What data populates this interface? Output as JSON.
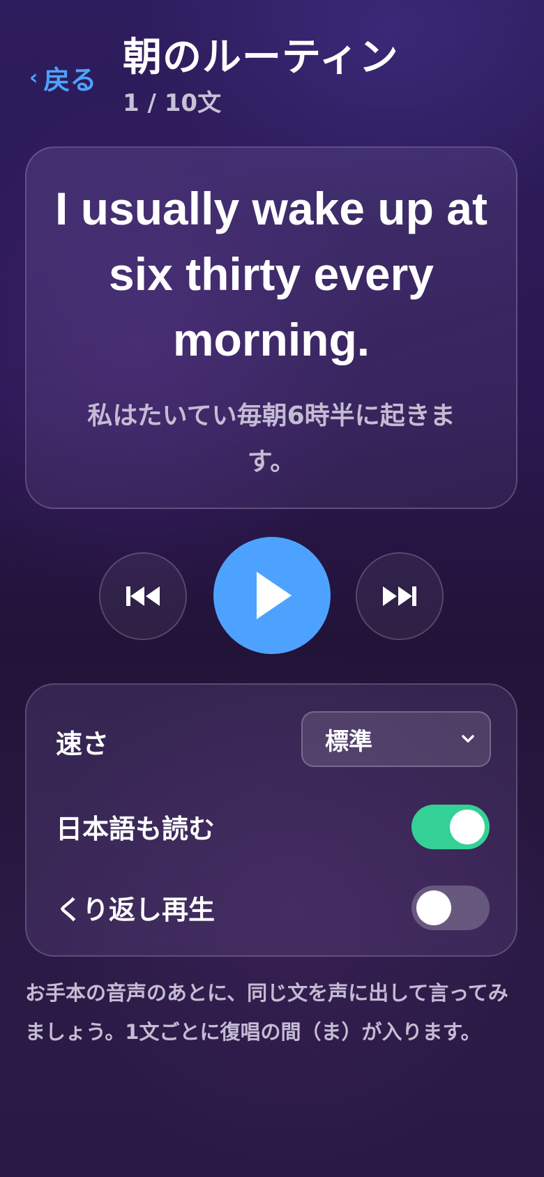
{
  "header": {
    "back_label": "戻る",
    "title": "朝のルーティン",
    "progress": "1 / 10文"
  },
  "sentence": {
    "english": "I usually wake up at six thirty every morning.",
    "japanese": "私はたいてい毎朝6時半に起きます。"
  },
  "controls": {
    "prev_icon": "skip-back-icon",
    "play_icon": "play-icon",
    "next_icon": "skip-forward-icon"
  },
  "settings": {
    "speed_label": "速さ",
    "speed_value": "標準",
    "read_japanese_label": "日本語も読む",
    "read_japanese_on": true,
    "repeat_label": "くり返し再生",
    "repeat_on": false
  },
  "hint": "お手本の音声のあとに、同じ文を声に出して言ってみましょう。1文ごとに復唱の間（ま）が入ります。",
  "colors": {
    "accent": "#4da2ff",
    "toggle_on": "#34d196"
  }
}
